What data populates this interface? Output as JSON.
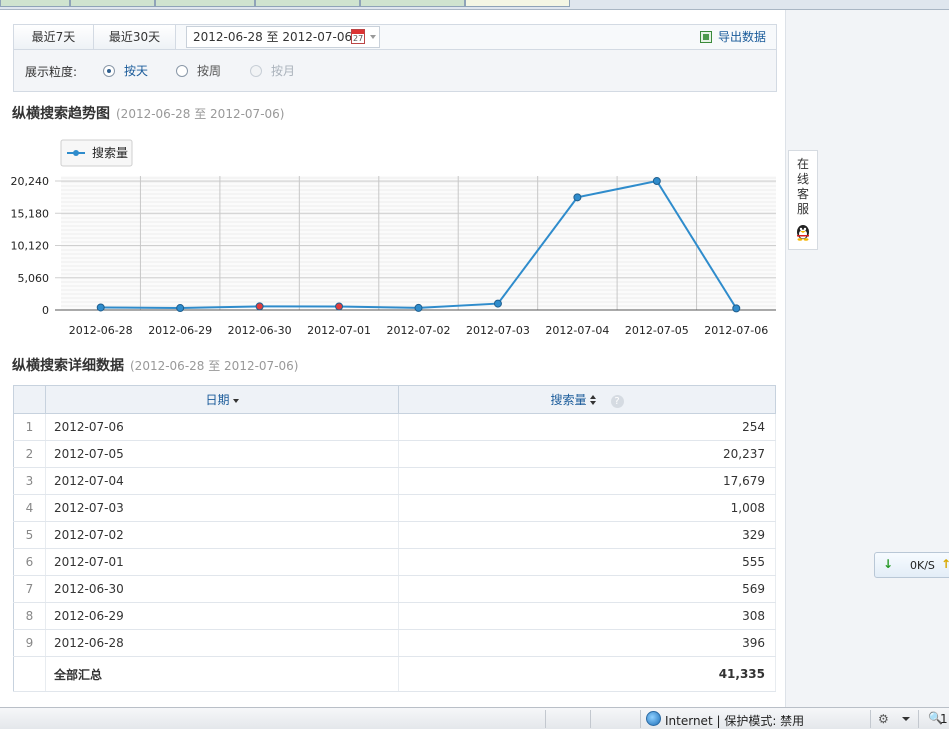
{
  "toolbar": {
    "last7": "最近7天",
    "last30": "最近30天",
    "date_range": "2012-06-28 至  2012-07-06",
    "calendar_day": "27",
    "export": "导出数据"
  },
  "granularity": {
    "label": "展示粒度:",
    "options": [
      {
        "label": "按天",
        "state": "selected"
      },
      {
        "label": "按周",
        "state": "enabled"
      },
      {
        "label": "按月",
        "state": "disabled"
      }
    ]
  },
  "trend": {
    "title": "纵横搜索趋势图",
    "range": "(2012-06-28 至  2012-07-06)"
  },
  "chart_data": {
    "type": "line",
    "categories": [
      "2012-06-28",
      "2012-06-29",
      "2012-06-30",
      "2012-07-01",
      "2012-07-02",
      "2012-07-03",
      "2012-07-04",
      "2012-07-05",
      "2012-07-06"
    ],
    "series": [
      {
        "name": "搜索量",
        "values": [
          396,
          308,
          569,
          555,
          329,
          1008,
          17679,
          20237,
          254
        ],
        "color": "#2f8ccc"
      }
    ],
    "highlighted_points": [
      2,
      3
    ],
    "highlight_color": "#e23b3b",
    "yticks": [
      "0",
      "5,060",
      "10,120",
      "15,180",
      "20,240"
    ],
    "ytick_values": [
      0,
      5060,
      10120,
      15180,
      20240
    ],
    "ylim": [
      0,
      20240
    ],
    "legend": "top-left",
    "grid": true
  },
  "detail": {
    "title": "纵横搜索详细数据",
    "range": "(2012-06-28 至  2012-07-06)",
    "columns": [
      "日期",
      "搜索量"
    ],
    "help": "?",
    "rows": [
      {
        "idx": "1",
        "date": "2012-07-06",
        "value": "254"
      },
      {
        "idx": "2",
        "date": "2012-07-05",
        "value": "20,237"
      },
      {
        "idx": "3",
        "date": "2012-07-04",
        "value": "17,679"
      },
      {
        "idx": "4",
        "date": "2012-07-03",
        "value": "1,008"
      },
      {
        "idx": "5",
        "date": "2012-07-02",
        "value": "329"
      },
      {
        "idx": "6",
        "date": "2012-07-01",
        "value": "555"
      },
      {
        "idx": "7",
        "date": "2012-06-30",
        "value": "569"
      },
      {
        "idx": "8",
        "date": "2012-06-29",
        "value": "308"
      },
      {
        "idx": "9",
        "date": "2012-06-28",
        "value": "396"
      }
    ],
    "total_label": "全部汇总",
    "total_value": "41,335"
  },
  "side": {
    "online_service": "在线客服",
    "speed": "0K/S",
    "down_arrow": "↓",
    "up_arrow": "↑"
  },
  "statusbar": {
    "zone": "Internet | 保护模式: 禁用",
    "zoom": "1"
  }
}
